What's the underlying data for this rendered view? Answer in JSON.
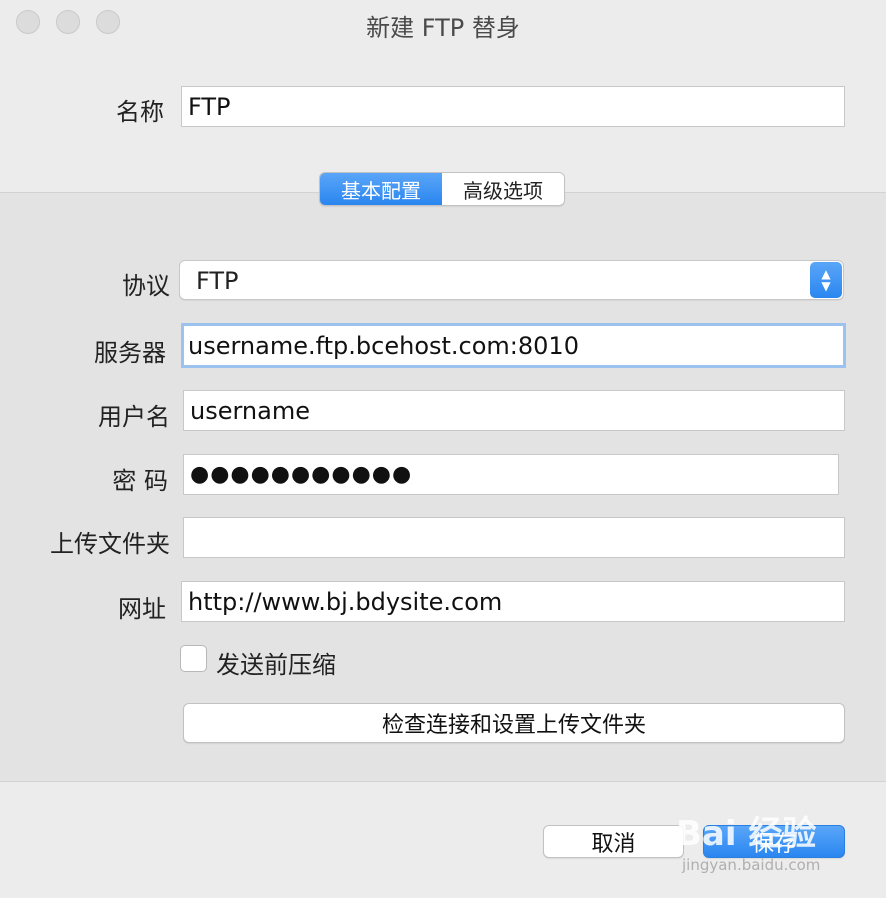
{
  "window": {
    "title": "新建 FTP 替身"
  },
  "name": {
    "label": "名称",
    "value": "FTP"
  },
  "tabs": [
    {
      "label": "基本配置",
      "active": true
    },
    {
      "label": "高级选项",
      "active": false
    }
  ],
  "form": {
    "protocol_label": "协议",
    "protocol_value": "FTP",
    "server_label": "服务器",
    "server_value": "username.ftp.bcehost.com:8010",
    "username_label": "用户名",
    "username_value": "username",
    "password_label": "密 码",
    "password_value": "●●●●●●●●●●●",
    "upload_folder_label": "上传文件夹",
    "upload_folder_value": "",
    "url_label": "网址",
    "url_value": "http://www.bj.bdysite.com",
    "compress_label": "发送前压缩",
    "compress_checked": false,
    "check_button": "检查连接和设置上传文件夹"
  },
  "footer": {
    "cancel": "取消",
    "save": "保存"
  },
  "watermark": {
    "logo": "Bai 经验",
    "site": "jingyan.baidu.com"
  },
  "colors": {
    "accent": "#2a86f0",
    "background": "#ececec",
    "panel": "#e3e3e3",
    "focus_ring": "#9cc3ef"
  }
}
